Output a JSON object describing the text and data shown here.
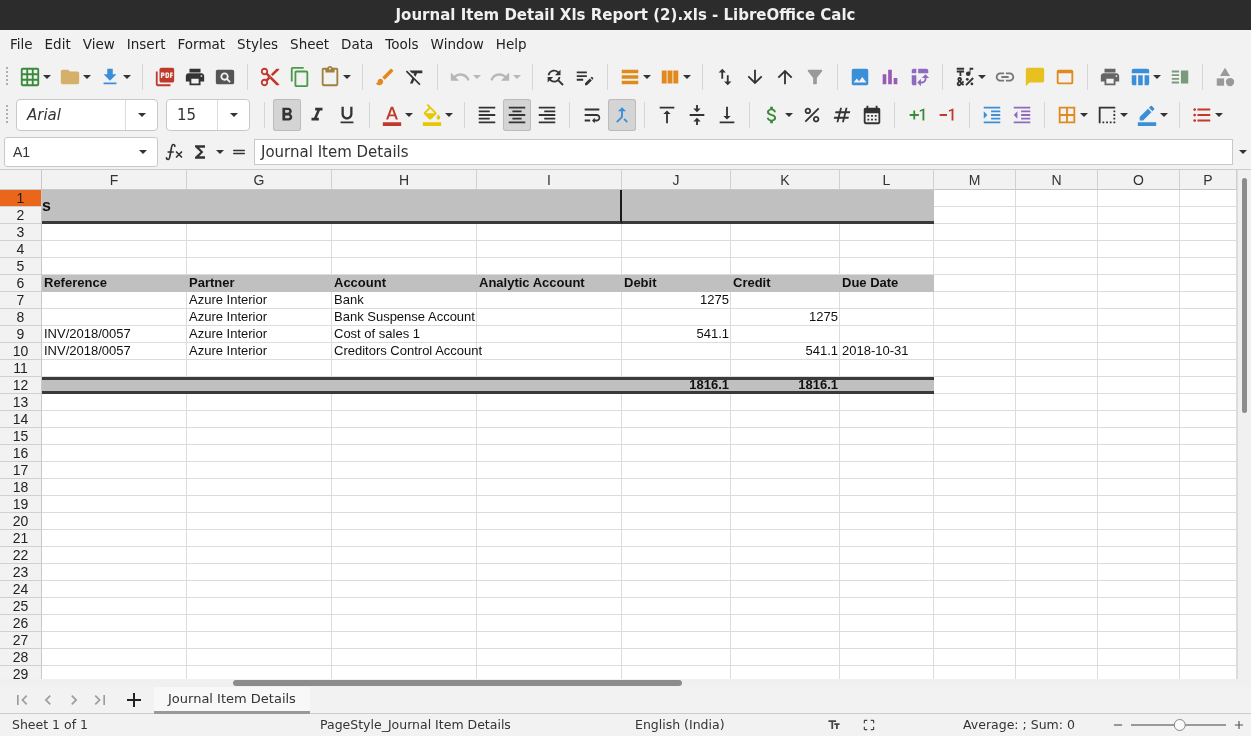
{
  "window": {
    "title": "Journal Item Detail Xls Report (2).xls - LibreOffice Calc"
  },
  "menu": [
    "File",
    "Edit",
    "View",
    "Insert",
    "Format",
    "Styles",
    "Sheet",
    "Data",
    "Tools",
    "Window",
    "Help"
  ],
  "standard_toolbar": [
    [
      {
        "kind": "new",
        "dropdown": true,
        "disabled": false
      },
      {
        "kind": "open",
        "dropdown": true,
        "disabled": false
      },
      {
        "kind": "save",
        "dropdown": true,
        "disabled": false
      }
    ],
    [
      {
        "kind": "pdf",
        "dropdown": false,
        "disabled": false
      },
      {
        "kind": "print",
        "dropdown": false,
        "disabled": false
      },
      {
        "kind": "preview",
        "dropdown": false,
        "disabled": false
      }
    ],
    [
      {
        "kind": "cut",
        "dropdown": false,
        "disabled": false
      },
      {
        "kind": "copy",
        "dropdown": false,
        "disabled": false
      },
      {
        "kind": "paste",
        "dropdown": true,
        "disabled": false
      }
    ],
    [
      {
        "kind": "clone",
        "dropdown": false,
        "disabled": false
      },
      {
        "kind": "clear",
        "dropdown": false,
        "disabled": false
      }
    ],
    [
      {
        "kind": "undo",
        "dropdown": true,
        "disabled": true
      },
      {
        "kind": "redo",
        "dropdown": true,
        "disabled": true
      }
    ],
    [
      {
        "kind": "find",
        "dropdown": false,
        "disabled": false
      },
      {
        "kind": "spell",
        "dropdown": false,
        "disabled": false
      }
    ],
    [
      {
        "kind": "row",
        "dropdown": true,
        "disabled": false
      },
      {
        "kind": "column",
        "dropdown": true,
        "disabled": false
      }
    ],
    [
      {
        "kind": "sort",
        "dropdown": false,
        "disabled": false
      },
      {
        "kind": "asc",
        "dropdown": false,
        "disabled": false
      },
      {
        "kind": "desc",
        "dropdown": false,
        "disabled": false
      },
      {
        "kind": "filter",
        "dropdown": false,
        "disabled": false
      }
    ],
    [
      {
        "kind": "image",
        "dropdown": false,
        "disabled": false
      },
      {
        "kind": "chart",
        "dropdown": false,
        "disabled": false
      },
      {
        "kind": "pivot",
        "dropdown": false,
        "disabled": false
      }
    ],
    [
      {
        "kind": "special",
        "dropdown": true,
        "disabled": false
      },
      {
        "kind": "link",
        "dropdown": false,
        "disabled": false
      },
      {
        "kind": "comment",
        "dropdown": false,
        "disabled": false
      },
      {
        "kind": "header",
        "dropdown": false,
        "disabled": false
      }
    ],
    [
      {
        "kind": "printrange",
        "dropdown": false,
        "disabled": false
      },
      {
        "kind": "freeze",
        "dropdown": true,
        "disabled": false
      },
      {
        "kind": "split",
        "dropdown": false,
        "disabled": false
      }
    ],
    [
      {
        "kind": "shape",
        "dropdown": false,
        "disabled": false
      }
    ]
  ],
  "formatting_toolbar": {
    "font_name": "Arial",
    "font_size": "15",
    "groups": [
      [
        {
          "kind": "bold",
          "dropdown": false,
          "pressed": true
        },
        {
          "kind": "italic",
          "dropdown": false,
          "pressed": false
        },
        {
          "kind": "underline",
          "dropdown": false,
          "pressed": false
        }
      ],
      [
        {
          "kind": "fontcolor",
          "dropdown": true,
          "pressed": false
        },
        {
          "kind": "highlight",
          "dropdown": true,
          "pressed": false
        }
      ],
      [
        {
          "kind": "left",
          "dropdown": false,
          "pressed": false
        },
        {
          "kind": "center",
          "dropdown": false,
          "pressed": true
        },
        {
          "kind": "right",
          "dropdown": false,
          "pressed": false
        }
      ],
      [
        {
          "kind": "wrap",
          "dropdown": false,
          "pressed": false
        },
        {
          "kind": "merge",
          "dropdown": false,
          "pressed": true
        }
      ],
      [
        {
          "kind": "top",
          "dropdown": false,
          "pressed": false
        },
        {
          "kind": "middle",
          "dropdown": false,
          "pressed": false
        },
        {
          "kind": "bottom",
          "dropdown": false,
          "pressed": false
        }
      ],
      [
        {
          "kind": "currency",
          "dropdown": true,
          "pressed": false
        },
        {
          "kind": "percent",
          "dropdown": false,
          "pressed": false
        },
        {
          "kind": "number",
          "dropdown": false,
          "pressed": false
        },
        {
          "kind": "date",
          "dropdown": false,
          "pressed": false
        }
      ],
      [
        {
          "kind": "adddec",
          "dropdown": false,
          "pressed": false
        },
        {
          "kind": "deldec",
          "dropdown": false,
          "pressed": false
        }
      ],
      [
        {
          "kind": "indent",
          "dropdown": false,
          "pressed": false
        },
        {
          "kind": "outdent",
          "dropdown": false,
          "pressed": false
        }
      ],
      [
        {
          "kind": "borders",
          "dropdown": true,
          "pressed": false
        },
        {
          "kind": "borderstyle",
          "dropdown": true,
          "pressed": false
        },
        {
          "kind": "bordercolor",
          "dropdown": true,
          "pressed": false
        }
      ],
      [
        {
          "kind": "conditional",
          "dropdown": true,
          "pressed": false
        }
      ]
    ]
  },
  "formula_bar": {
    "name_box": "A1",
    "value": "Journal Item Details"
  },
  "sheet": {
    "columns": [
      "F",
      "G",
      "H",
      "I",
      "J",
      "K",
      "L",
      "M",
      "N",
      "O",
      "P"
    ],
    "rows": [
      {
        "label": "1",
        "selected": true,
        "kind": "title",
        "cells": [
          "s"
        ]
      },
      {
        "label": "2",
        "selected": false,
        "kind": "title",
        "cells": []
      },
      {
        "label": "3",
        "selected": false,
        "kind": "blank",
        "cells": []
      },
      {
        "label": "4",
        "selected": false,
        "kind": "blank",
        "cells": []
      },
      {
        "label": "5",
        "selected": false,
        "kind": "blank",
        "cells": []
      },
      {
        "label": "6",
        "selected": false,
        "kind": "header",
        "cells": [
          "Reference",
          "Partner",
          "Account",
          "Analytic Account",
          "Debit",
          "Credit",
          "Due Date"
        ]
      },
      {
        "label": "7",
        "selected": false,
        "kind": "data",
        "cells": [
          "",
          "Azure Interior",
          "Bank",
          "",
          "1275",
          "",
          ""
        ]
      },
      {
        "label": "8",
        "selected": false,
        "kind": "data",
        "cells": [
          "",
          "Azure Interior",
          "Bank Suspense Account",
          "",
          "",
          "1275",
          ""
        ]
      },
      {
        "label": "9",
        "selected": false,
        "kind": "data",
        "cells": [
          "INV/2018/0057",
          "Azure Interior",
          "Cost of sales 1",
          "",
          "541.1",
          "",
          ""
        ]
      },
      {
        "label": "10",
        "selected": false,
        "kind": "data",
        "cells": [
          "INV/2018/0057",
          "Azure Interior",
          "Creditors Control Account",
          "",
          "",
          "541.1",
          "2018-10-31"
        ]
      },
      {
        "label": "11",
        "selected": false,
        "kind": "blank",
        "cells": []
      },
      {
        "label": "12",
        "selected": false,
        "kind": "total",
        "cells": [
          "",
          "",
          "",
          "",
          "1816.1",
          "1816.1",
          ""
        ]
      },
      {
        "label": "13",
        "selected": false,
        "kind": "blank",
        "cells": []
      },
      {
        "label": "14",
        "selected": false,
        "kind": "blank",
        "cells": []
      },
      {
        "label": "15",
        "selected": false,
        "kind": "blank",
        "cells": []
      },
      {
        "label": "16",
        "selected": false,
        "kind": "blank",
        "cells": []
      },
      {
        "label": "17",
        "selected": false,
        "kind": "blank",
        "cells": []
      },
      {
        "label": "18",
        "selected": false,
        "kind": "blank",
        "cells": []
      },
      {
        "label": "19",
        "selected": false,
        "kind": "blank",
        "cells": []
      },
      {
        "label": "20",
        "selected": false,
        "kind": "blank",
        "cells": []
      },
      {
        "label": "21",
        "selected": false,
        "kind": "blank",
        "cells": []
      },
      {
        "label": "22",
        "selected": false,
        "kind": "blank",
        "cells": []
      },
      {
        "label": "23",
        "selected": false,
        "kind": "blank",
        "cells": []
      },
      {
        "label": "24",
        "selected": false,
        "kind": "blank",
        "cells": []
      },
      {
        "label": "25",
        "selected": false,
        "kind": "blank",
        "cells": []
      },
      {
        "label": "26",
        "selected": false,
        "kind": "blank",
        "cells": []
      },
      {
        "label": "27",
        "selected": false,
        "kind": "blank",
        "cells": []
      },
      {
        "label": "28",
        "selected": false,
        "kind": "blank",
        "cells": []
      },
      {
        "label": "29",
        "selected": false,
        "kind": "blank",
        "cells": []
      }
    ]
  },
  "sheet_tabs": [
    {
      "label": "Journal Item Details",
      "selected": true
    }
  ],
  "status_bar": {
    "sheet": "Sheet 1 of 1",
    "page_style": "PageStyle_Journal Item Details",
    "language": "English (India)",
    "summary": "Average: ; Sum: 0",
    "zoom": {
      "level": 0.52
    }
  }
}
